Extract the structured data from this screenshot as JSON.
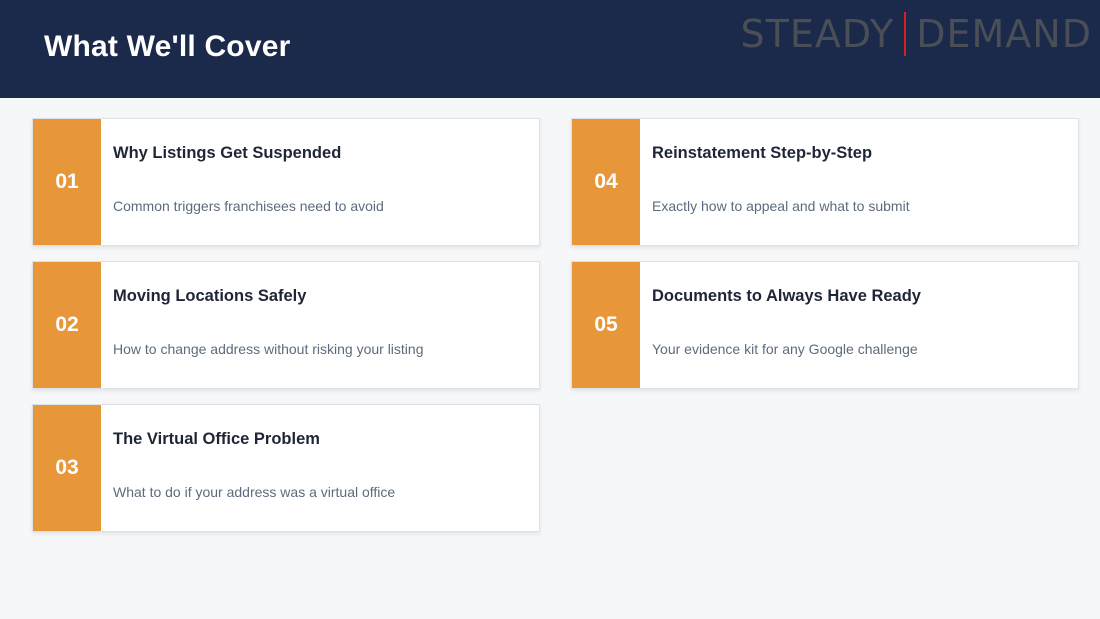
{
  "header": {
    "title": "What We'll Cover",
    "logo_left": "STEADY",
    "logo_right": "DEMAND"
  },
  "colors": {
    "header_bg": "#1b2a4a",
    "accent": "#e8963a",
    "logo_divider": "#d32020"
  },
  "items": [
    {
      "number": "01",
      "title": "Why Listings Get Suspended",
      "description": "Common triggers franchisees need to avoid"
    },
    {
      "number": "02",
      "title": "Moving Locations Safely",
      "description": "How to change address without risking your listing"
    },
    {
      "number": "03",
      "title": "The Virtual Office Problem",
      "description": "What to do if your address was a virtual office"
    },
    {
      "number": "04",
      "title": "Reinstatement Step-by-Step",
      "description": "Exactly how to appeal and what to submit"
    },
    {
      "number": "05",
      "title": "Documents to Always Have Ready",
      "description": "Your evidence kit for any Google challenge"
    }
  ]
}
